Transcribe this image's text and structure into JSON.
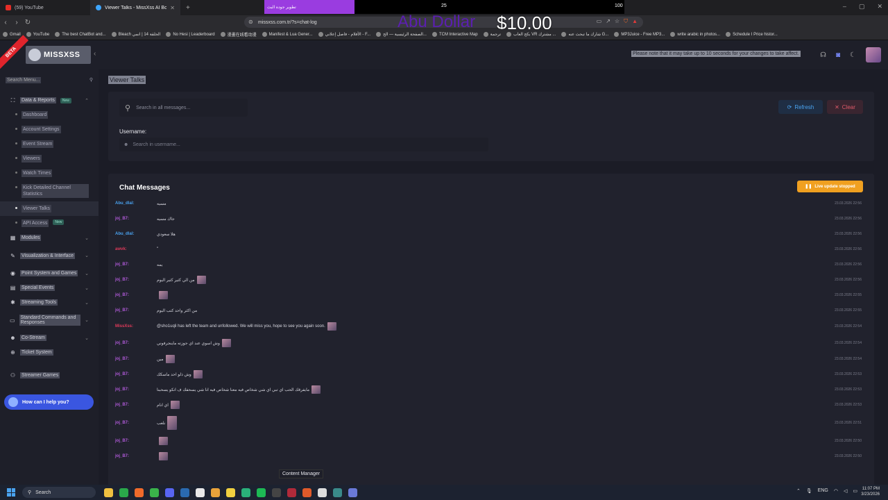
{
  "browser": {
    "tabs": [
      {
        "label": "(59) YouTube",
        "active": false
      },
      {
        "label": "Viewer Talks - MissXss AI Bot Syste",
        "active": true
      }
    ],
    "overlay_purple_text": "تطوير جودة البث",
    "overlay_num_1": "25",
    "overlay_num_2": "100",
    "url": "missxss.com.tr/?s=chat-log",
    "donor_name": "Abu Dollar",
    "donor_amount": "$10.00",
    "bookmarks": [
      "Gmail",
      "YouTube",
      "The best ChatBot and...",
      "Bleach الحلقة 14 | انمي",
      "No Hesi | Leaderboard",
      "漫畫在线看动漫",
      "Manifest & Lua Gener...",
      "الأفلام - فاصل إعلاني - F...",
      "الصفحة الرئيسية — الح...",
      "TCM Interactive Map",
      "ترجمة",
      "بكج العاب VR مشترك ...",
      "شارك ما تبحث عنه G...",
      "MP3Juice - Free MP3...",
      "write arabic in photos...",
      "Schedule I Price histor..."
    ]
  },
  "app": {
    "beta": "BETA",
    "logo": "MISSXSS",
    "notice": "Please note that it may take up to 10 seconds for your changes to take affect.",
    "search_menu_placeholder": "Search Menu...",
    "nav": [
      {
        "type": "section",
        "icon": "⛶",
        "label": "Data & Reports",
        "badge": "New",
        "chev": "⌃"
      },
      {
        "type": "sub",
        "label": "Dashboard"
      },
      {
        "type": "sub",
        "label": "Account Settings"
      },
      {
        "type": "sub",
        "label": "Event Stream"
      },
      {
        "type": "sub",
        "label": "Viewers"
      },
      {
        "type": "sub",
        "label": "Watch Times"
      },
      {
        "type": "sub",
        "label": "Kick Detailed Channel Statistics"
      },
      {
        "type": "sub",
        "label": "Viewer Talks",
        "active": true
      },
      {
        "type": "sub",
        "label": "API Access",
        "badge": "New"
      },
      {
        "type": "section",
        "icon": "▦",
        "label": "Modules",
        "chev": "⌄"
      },
      {
        "type": "section",
        "icon": "✎",
        "label": "Visualization & Interface",
        "chev": "⌄"
      },
      {
        "type": "section",
        "icon": "◉",
        "label": "Point System and Games",
        "chev": "⌄"
      },
      {
        "type": "section",
        "icon": "▤",
        "label": "Special Events",
        "chev": "⌄"
      },
      {
        "type": "section",
        "icon": "✱",
        "label": "Streaming Tools",
        "chev": "⌄"
      },
      {
        "type": "section",
        "icon": "▭",
        "label": "Standard Commands and Responses",
        "chev": "⌄"
      },
      {
        "type": "section",
        "icon": "☻",
        "label": "Co-Stream",
        "chev": "⌄"
      },
      {
        "type": "section",
        "icon": "⊕",
        "label": "Ticket System",
        "chev": ""
      },
      {
        "type": "gap"
      },
      {
        "type": "section",
        "icon": "⚇",
        "label": "Streamer Games",
        "chev": ""
      }
    ],
    "help_label": "How can I help you?",
    "page_title": "Viewer Talks",
    "search_placeholder": "Search in all messages...",
    "refresh_label": "Refresh",
    "clear_label": "Clear",
    "username_label": "Username:",
    "username_placeholder": "Search in username...",
    "chat_title": "Chat Messages",
    "live_label": "Live update stopped",
    "tooltip": "Content Manager"
  },
  "messages": [
    {
      "user": "Abu_dlal:",
      "color": "#4aa3f0",
      "text": "مسيه",
      "thumb": "",
      "time": "23.03.2026 22:56"
    },
    {
      "user": "joj_B7:",
      "color": "#b05ad8",
      "text": "جاك مسيه",
      "thumb": "",
      "time": "23.03.2026 22:56"
    },
    {
      "user": "Abu_dlal:",
      "color": "#4aa3f0",
      "text": "هلا سعودي",
      "thumb": "",
      "time": "23.03.2026 22:56"
    },
    {
      "user": "awvk:",
      "color": "#e03a5a",
      "text": "\"",
      "thumb": "",
      "time": "23.03.2026 22:56"
    },
    {
      "user": "joj_B7:",
      "color": "#b05ad8",
      "text": "يمه",
      "thumb": "",
      "time": "23.03.2026 22:56"
    },
    {
      "user": "joj_B7:",
      "color": "#b05ad8",
      "text": "من الي كثير كثير اليوم",
      "thumb": "sm",
      "time": "23.03.2026 22:56"
    },
    {
      "user": "joj_B7:",
      "color": "#b05ad8",
      "text": "",
      "thumb": "sm",
      "time": "23.03.2026 22:55"
    },
    {
      "user": "joj_B7:",
      "color": "#b05ad8",
      "text": "من اكثر واحد كتب اليوم",
      "thumb": "",
      "time": "23.03.2026 22:55"
    },
    {
      "user": "MissXss:",
      "color": "#e03a5a",
      "text": "@sho1uqli has left the team and unfollowed. We will miss you, hope to see you again soon.",
      "thumb": "sm",
      "time": "23.03.2026 22:54"
    },
    {
      "user": "joj_B7:",
      "color": "#b05ad8",
      "text": "وش اسوي عند اي جوزته ماينجرفوني",
      "thumb": "sm",
      "time": "23.03.2026 22:54"
    },
    {
      "user": "joj_B7:",
      "color": "#b05ad8",
      "text": "مين",
      "thumb": "sm",
      "time": "23.03.2026 22:54"
    },
    {
      "user": "joj_B7:",
      "color": "#b05ad8",
      "text": "وش ذلو احد ماسكك",
      "thumb": "sm",
      "time": "23.03.2026 22:53"
    },
    {
      "user": "joj_B7:",
      "color": "#b05ad8",
      "text": "مايفرقك الحب اي تبي اي شي شخاص فيه معنا شخاص فيه انا شي يسحفك ف انكو يسحبنا",
      "thumb": "sm",
      "time": "23.03.2026 22:53"
    },
    {
      "user": "joj_B7:",
      "color": "#b05ad8",
      "text": "اي انام",
      "thumb": "sm",
      "time": "23.03.2026 22:53"
    },
    {
      "user": "joj_B7:",
      "color": "#b05ad8",
      "text": "نلعب",
      "thumb": "tall",
      "time": "23.03.2026 22:51"
    },
    {
      "user": "joj_B7:",
      "color": "#b05ad8",
      "text": "",
      "thumb": "sm",
      "time": "23.03.2026 22:50"
    },
    {
      "user": "joj_B7:",
      "color": "#b05ad8",
      "text": "",
      "thumb": "sm",
      "time": "23.03.2026 22:50"
    }
  ],
  "taskbar": {
    "search": "Search",
    "lang": "ENG",
    "time": "11:07 PM",
    "date": "3/23/2026"
  }
}
